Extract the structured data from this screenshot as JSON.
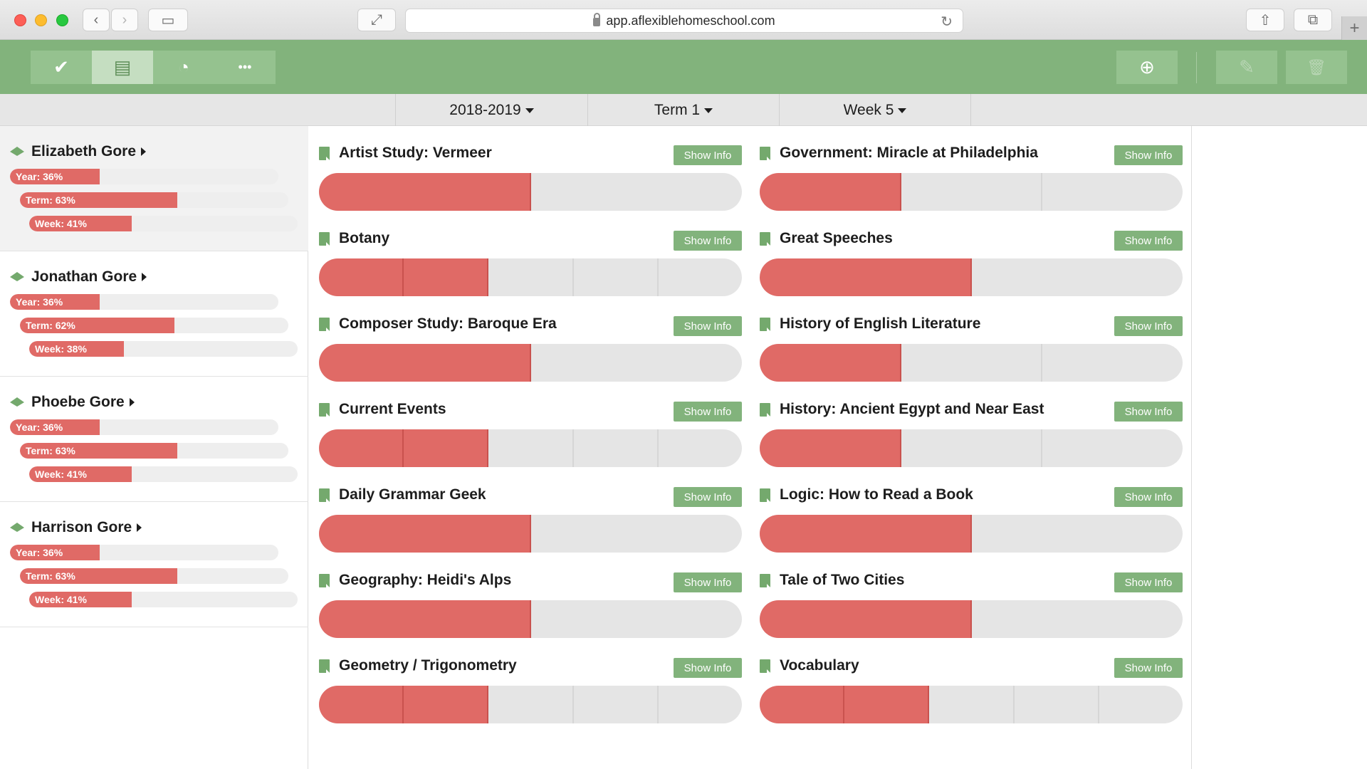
{
  "browser": {
    "url": "app.aflexiblehomeschool.com"
  },
  "toolbar": {
    "views": [
      {
        "name": "checkmark-icon",
        "glyph": "✔"
      },
      {
        "name": "timeline-icon",
        "glyph": "▤"
      },
      {
        "name": "pie-chart-icon",
        "glyph": "◔"
      },
      {
        "name": "more-icon",
        "glyph": "•••"
      }
    ],
    "active_view": 1,
    "add_glyph": "⊕",
    "edit_glyph": "✎",
    "delete_glyph": "🗑"
  },
  "filters": {
    "year": "2018-2019",
    "term": "Term 1",
    "week": "Week 5"
  },
  "students": [
    {
      "name": "Elizabeth Gore",
      "year_label": "Year: 36%",
      "year": 36,
      "term_label": "Term: 63%",
      "term": 63,
      "week_label": "Week: 41%",
      "week": 41
    },
    {
      "name": "Jonathan Gore",
      "year_label": "Year: 36%",
      "year": 36,
      "term_label": "Term: 62%",
      "term": 62,
      "week_label": "Week: 38%",
      "week": 38
    },
    {
      "name": "Phoebe Gore",
      "year_label": "Year: 36%",
      "year": 36,
      "term_label": "Term: 63%",
      "term": 63,
      "week_label": "Week: 41%",
      "week": 41
    },
    {
      "name": "Harrison Gore",
      "year_label": "Year: 36%",
      "year": 36,
      "term_label": "Term: 63%",
      "term": 63,
      "week_label": "Week: 41%",
      "week": 41
    }
  ],
  "show_info_label": "Show Info",
  "courses_left": [
    {
      "title": "Artist Study: Vermeer",
      "total": 2,
      "done": 1
    },
    {
      "title": "Botany",
      "total": 5,
      "done": 2
    },
    {
      "title": "Composer Study: Baroque Era",
      "total": 2,
      "done": 1
    },
    {
      "title": "Current Events",
      "total": 5,
      "done": 2
    },
    {
      "title": "Daily Grammar Geek",
      "total": 2,
      "done": 1
    },
    {
      "title": "Geography: Heidi's Alps",
      "total": 2,
      "done": 1
    },
    {
      "title": "Geometry / Trigonometry",
      "total": 5,
      "done": 2
    }
  ],
  "courses_right": [
    {
      "title": "Government: Miracle at Philadelphia",
      "total": 3,
      "done": 1
    },
    {
      "title": "Great Speeches",
      "total": 2,
      "done": 1
    },
    {
      "title": "History of English Literature",
      "total": 3,
      "done": 1
    },
    {
      "title": "History: Ancient Egypt and Near East",
      "total": 3,
      "done": 1
    },
    {
      "title": "Logic: How to Read a Book",
      "total": 2,
      "done": 1
    },
    {
      "title": "Tale of Two Cities",
      "total": 2,
      "done": 1
    },
    {
      "title": "Vocabulary",
      "total": 5,
      "done": 2
    }
  ]
}
